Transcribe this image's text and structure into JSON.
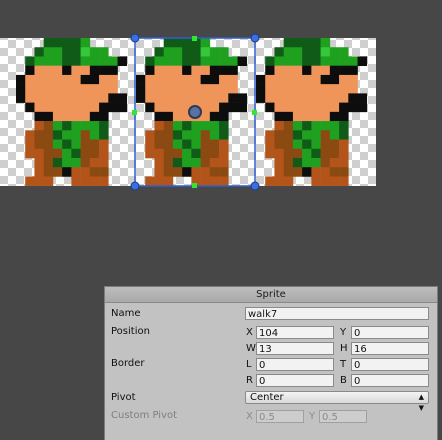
{
  "sprite_panel": {
    "header": "Sprite",
    "name_label": "Name",
    "name_value": "walk7",
    "position_label": "Position",
    "x_label": "X",
    "x_value": "104",
    "y_label": "Y",
    "y_value": "0",
    "w_label": "W",
    "w_value": "13",
    "h_label": "H",
    "h_value": "16",
    "border_label": "Border",
    "l_label": "L",
    "l_value": "0",
    "t_label": "T",
    "t_value": "0",
    "r_label": "R",
    "r_value": "0",
    "b_label": "B",
    "b_value": "0",
    "pivot_label": "Pivot",
    "pivot_value": "Center",
    "custom_pivot_label": "Custom Pivot",
    "cp_x_label": "X",
    "cp_x_value": "0.5",
    "cp_y_label": "Y",
    "cp_y_value": "0.5"
  },
  "sprite_sheet": {
    "frame_count": 3,
    "selected_frame": 2,
    "colors": {
      "dark_green": "#0f5b17",
      "green": "#1fa01f",
      "light_green": "#35c83a",
      "skin": "#f0955a",
      "black": "#0d0d0d",
      "brown": "#8a4a12",
      "orange_brown": "#b3551a",
      "selection": "#2f5fd0",
      "handle": "#3a6fe0",
      "green_handle": "#2ee82e"
    }
  }
}
